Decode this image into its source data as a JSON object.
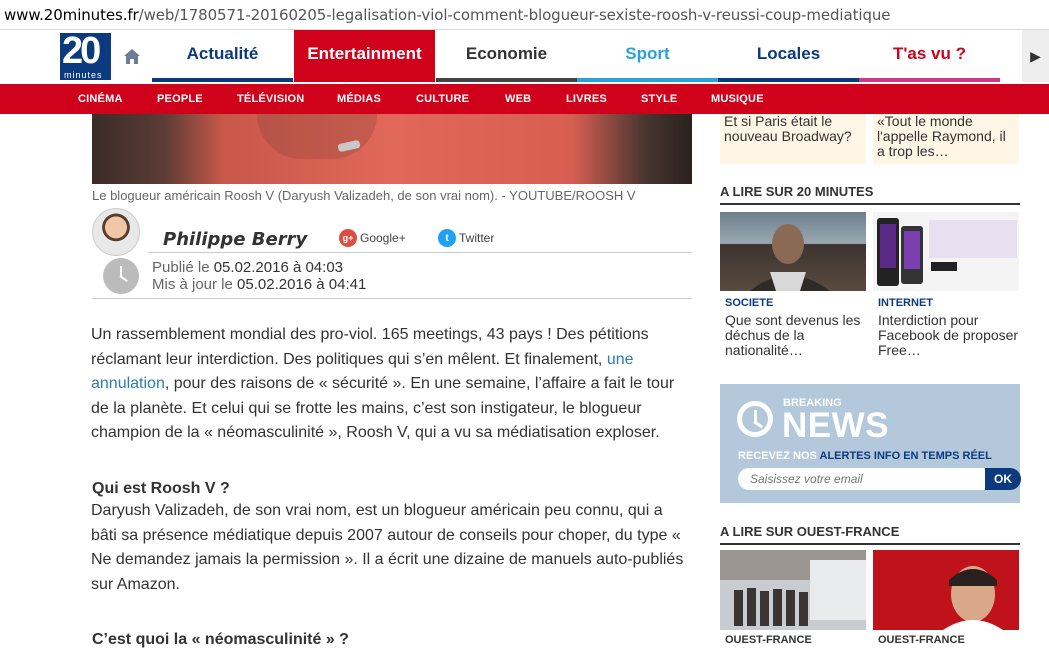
{
  "browser": {
    "url_domain": "www.20minutes.fr",
    "url_path": "/web/1780571-20160205-legalisation-viol-comment-blogueur-sexiste-roosh-v-reussi-coup-mediatique"
  },
  "logo": {
    "number": "20",
    "word": "minutes"
  },
  "nav": {
    "tabs": [
      {
        "label": "Actualité",
        "color": "#0b3a7e"
      },
      {
        "label": "Entertainment",
        "color": "#ffffff"
      },
      {
        "label": "Economie",
        "color": "#333333"
      },
      {
        "label": "Sport",
        "color": "#2aa0dc"
      },
      {
        "label": "Locales",
        "color": "#0b3a7e"
      },
      {
        "label": "T'as vu ?",
        "color": "#d0021b"
      }
    ],
    "subnav": [
      "CINÉMA",
      "PEOPLE",
      "TÉLÉVISION",
      "MÉDIAS",
      "CULTURE",
      "WEB",
      "LIVRES",
      "STYLE",
      "MUSIQUE"
    ]
  },
  "article": {
    "caption": "Le blogueur américain Roosh V (Daryush Valizadeh, de son vrai nom). - YOUTUBE/ROOSH V",
    "author": "Philippe Berry",
    "share_google": "Google+",
    "share_twitter": "Twitter",
    "published_label": "Publié le",
    "published": "05.02.2016 à 04:03",
    "updated_label": "Mis à jour le",
    "updated": "05.02.2016 à 04:41",
    "p1_before_link": "Un rassemblement mondial des pro-viol. 165 meetings, 43 pays ! Des pétitions réclamant leur interdiction. Des politiques qui s’en mêlent. Et finalement, ",
    "p1_link": "une annulation",
    "p1_after_link": ", pour des raisons de « sécurité ». En une semaine, l’affaire a fait le tour de la planète. Et celui qui se frotte les mains, c’est son instigateur, le blogueur champion de la « néomasculinité », Roosh V, qui a vu sa médiatisation exploser.",
    "h1": "Qui est Roosh V ?",
    "p2": "Daryush Valizadeh, de son vrai nom, est un blogueur américain peu connu, qui a bâti sa présence médiatique depuis 2007 autour de conseils pour choper, du type « Ne demandez jamais la permission ». Il a écrit une dizaine de manuels auto-publiés sur Amazon.",
    "h2": "C’est quoi la « néomasculinité » ?"
  },
  "sidebar": {
    "top_cards": [
      "Et si Paris était le nouveau Broadway?",
      "«Tout le monde l'appelle Raymond, il a trop les…"
    ],
    "section1_title": "A LIRE SUR 20 MINUTES",
    "items": [
      {
        "tag": "SOCIETE",
        "title": "Que sont devenus les déchus de la nationalité…"
      },
      {
        "tag": "INTERNET",
        "title": "Interdiction pour Facebook de proposer Free…"
      }
    ],
    "breaking": {
      "label": "BREAKING",
      "word": "NEWS",
      "sub_before": "RECEVEZ NOS ",
      "sub_highlight": "ALERTES INFO EN TEMPS RÉEL",
      "placeholder": "Saisissez votre email",
      "ok": "OK"
    },
    "section2_title": "A LIRE SUR OUEST-FRANCE",
    "of_items": [
      {
        "tag": "OUEST-FRANCE"
      },
      {
        "tag": "OUEST-FRANCE"
      }
    ]
  }
}
